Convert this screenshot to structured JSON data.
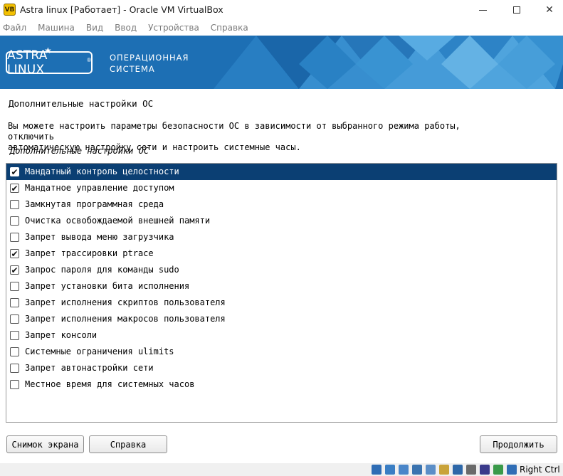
{
  "window": {
    "title": "Astra linux [Работает] - Oracle VM VirtualBox",
    "app_icon_glyph": "VB"
  },
  "menu": [
    "Файл",
    "Машина",
    "Вид",
    "Ввод",
    "Устройства",
    "Справка"
  ],
  "banner": {
    "logo": "ASTRA LINUX",
    "logo_mark": "®",
    "subtitle_line1": "ОПЕРАЦИОННАЯ",
    "subtitle_line2": "СИСТЕМА",
    "color": "#1d6fb4"
  },
  "page": {
    "title": "Дополнительные настройки ОС",
    "description_line1": "Вы можете настроить параметры безопасности ОС в зависимости от выбранного режима работы, отключить",
    "description_line2": "автоматическую настройку сети и настроить системные часы.",
    "list_caption": "Дополнительные настройки ОС"
  },
  "options": [
    {
      "label": "Мандатный контроль целостности",
      "checked": true,
      "selected": true
    },
    {
      "label": "Мандатное управление доступом",
      "checked": true,
      "selected": false
    },
    {
      "label": "Замкнутая программная среда",
      "checked": false,
      "selected": false
    },
    {
      "label": "Очистка освобождаемой внешней памяти",
      "checked": false,
      "selected": false
    },
    {
      "label": "Запрет вывода меню загрузчика",
      "checked": false,
      "selected": false
    },
    {
      "label": "Запрет трассировки ptrace",
      "checked": true,
      "selected": false
    },
    {
      "label": "Запрос пароля для команды sudo",
      "checked": true,
      "selected": false
    },
    {
      "label": "Запрет установки бита исполнения",
      "checked": false,
      "selected": false
    },
    {
      "label": "Запрет исполнения скриптов пользователя",
      "checked": false,
      "selected": false
    },
    {
      "label": "Запрет исполнения макросов пользователя",
      "checked": false,
      "selected": false
    },
    {
      "label": "Запрет консоли",
      "checked": false,
      "selected": false
    },
    {
      "label": "Системные ограничения ulimits",
      "checked": false,
      "selected": false
    },
    {
      "label": "Запрет автонастройки сети",
      "checked": false,
      "selected": false
    },
    {
      "label": "Местное время для системных часов",
      "checked": false,
      "selected": false
    }
  ],
  "buttons": {
    "screenshot": "Снимок экрана",
    "help": "Справка",
    "continue": "Продолжить"
  },
  "statusbar": {
    "host_key": "Right Ctrl",
    "icons": [
      "hdd-icon",
      "optical-drive-icon",
      "audio-icon",
      "network-icon",
      "usb-icon",
      "shared-folders-icon",
      "display-icon",
      "recording-icon",
      "cpu-icon",
      "mouse-integration-icon",
      "keyboard-icon"
    ]
  },
  "colors": {
    "selection": "#0b3f73",
    "banner": "#1d6fb4"
  }
}
